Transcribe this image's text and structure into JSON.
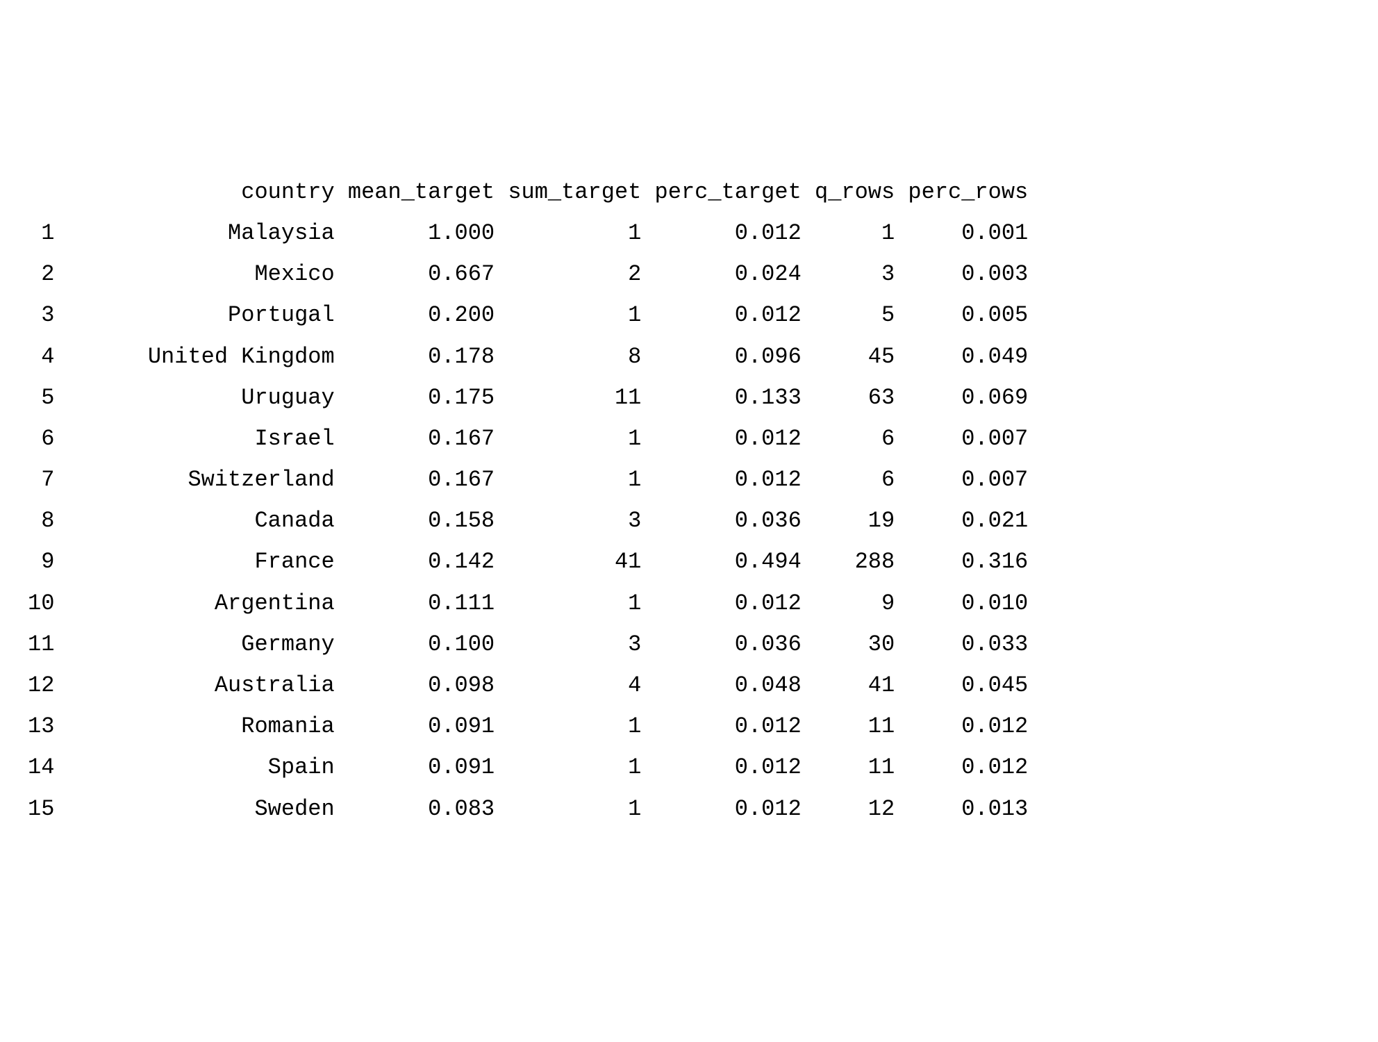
{
  "table": {
    "columns": [
      "country",
      "mean_target",
      "sum_target",
      "perc_target",
      "q_rows",
      "perc_rows"
    ],
    "rows": [
      {
        "idx": "1",
        "country": "Malaysia",
        "mean_target": "1.000",
        "sum_target": "1",
        "perc_target": "0.012",
        "q_rows": "1",
        "perc_rows": "0.001"
      },
      {
        "idx": "2",
        "country": "Mexico",
        "mean_target": "0.667",
        "sum_target": "2",
        "perc_target": "0.024",
        "q_rows": "3",
        "perc_rows": "0.003"
      },
      {
        "idx": "3",
        "country": "Portugal",
        "mean_target": "0.200",
        "sum_target": "1",
        "perc_target": "0.012",
        "q_rows": "5",
        "perc_rows": "0.005"
      },
      {
        "idx": "4",
        "country": "United Kingdom",
        "mean_target": "0.178",
        "sum_target": "8",
        "perc_target": "0.096",
        "q_rows": "45",
        "perc_rows": "0.049"
      },
      {
        "idx": "5",
        "country": "Uruguay",
        "mean_target": "0.175",
        "sum_target": "11",
        "perc_target": "0.133",
        "q_rows": "63",
        "perc_rows": "0.069"
      },
      {
        "idx": "6",
        "country": "Israel",
        "mean_target": "0.167",
        "sum_target": "1",
        "perc_target": "0.012",
        "q_rows": "6",
        "perc_rows": "0.007"
      },
      {
        "idx": "7",
        "country": "Switzerland",
        "mean_target": "0.167",
        "sum_target": "1",
        "perc_target": "0.012",
        "q_rows": "6",
        "perc_rows": "0.007"
      },
      {
        "idx": "8",
        "country": "Canada",
        "mean_target": "0.158",
        "sum_target": "3",
        "perc_target": "0.036",
        "q_rows": "19",
        "perc_rows": "0.021"
      },
      {
        "idx": "9",
        "country": "France",
        "mean_target": "0.142",
        "sum_target": "41",
        "perc_target": "0.494",
        "q_rows": "288",
        "perc_rows": "0.316"
      },
      {
        "idx": "10",
        "country": "Argentina",
        "mean_target": "0.111",
        "sum_target": "1",
        "perc_target": "0.012",
        "q_rows": "9",
        "perc_rows": "0.010"
      },
      {
        "idx": "11",
        "country": "Germany",
        "mean_target": "0.100",
        "sum_target": "3",
        "perc_target": "0.036",
        "q_rows": "30",
        "perc_rows": "0.033"
      },
      {
        "idx": "12",
        "country": "Australia",
        "mean_target": "0.098",
        "sum_target": "4",
        "perc_target": "0.048",
        "q_rows": "41",
        "perc_rows": "0.045"
      },
      {
        "idx": "13",
        "country": "Romania",
        "mean_target": "0.091",
        "sum_target": "1",
        "perc_target": "0.012",
        "q_rows": "11",
        "perc_rows": "0.012"
      },
      {
        "idx": "14",
        "country": "Spain",
        "mean_target": "0.091",
        "sum_target": "1",
        "perc_target": "0.012",
        "q_rows": "11",
        "perc_rows": "0.012"
      },
      {
        "idx": "15",
        "country": "Sweden",
        "mean_target": "0.083",
        "sum_target": "1",
        "perc_target": "0.012",
        "q_rows": "12",
        "perc_rows": "0.013"
      }
    ]
  }
}
